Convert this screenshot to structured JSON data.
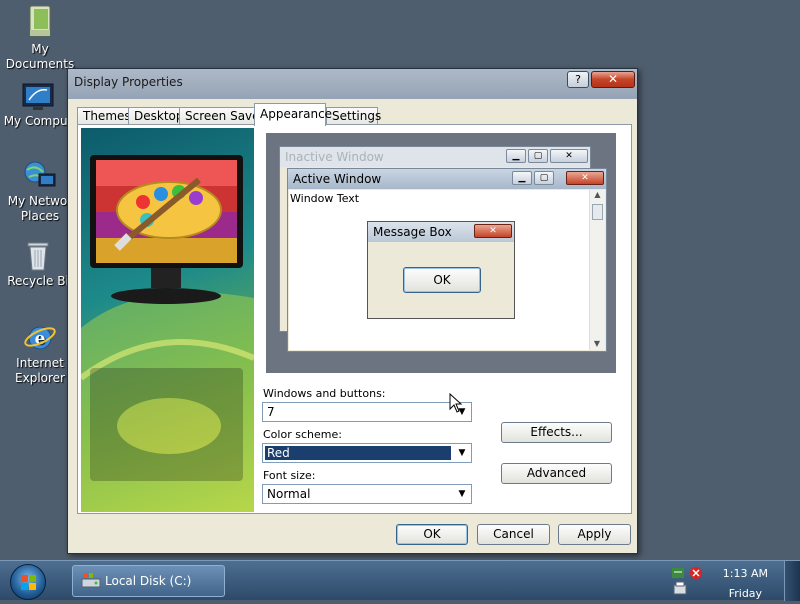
{
  "desktop": {
    "icons": [
      {
        "label": "My Documents"
      },
      {
        "label": "My Comput"
      },
      {
        "label": "My Networ Places"
      },
      {
        "label": "Recycle Bi"
      },
      {
        "label": "Internet Explorer"
      }
    ]
  },
  "window": {
    "title": "Display Properties",
    "help_glyph": "?",
    "close_glyph": "✕",
    "tabs": [
      {
        "label": "Themes"
      },
      {
        "label": "Desktop"
      },
      {
        "label": "Screen Saver"
      },
      {
        "label": "Appearance",
        "active": true
      },
      {
        "label": "Settings"
      }
    ],
    "preview": {
      "inactive_title": "Inactive Window",
      "active_title": "Active Window",
      "window_text": "Window Text",
      "message_title": "Message Box",
      "message_ok": "OK"
    },
    "fields": {
      "windows_buttons_label": "Windows and buttons:",
      "windows_buttons_value": "7",
      "color_scheme_label": "Color scheme:",
      "color_scheme_value": "Red",
      "font_size_label": "Font size:",
      "font_size_value": "Normal"
    },
    "buttons": {
      "effects": "Effects...",
      "advanced": "Advanced",
      "ok": "OK",
      "cancel": "Cancel",
      "apply": "Apply"
    }
  },
  "taskbar": {
    "task_label": "Local Disk (C:)",
    "time": "1:13 AM",
    "day": "Friday"
  },
  "colors": {
    "desktop_bg": "#4f5e6e",
    "selection": "#1a3f6e",
    "close_red": "#c54326"
  }
}
